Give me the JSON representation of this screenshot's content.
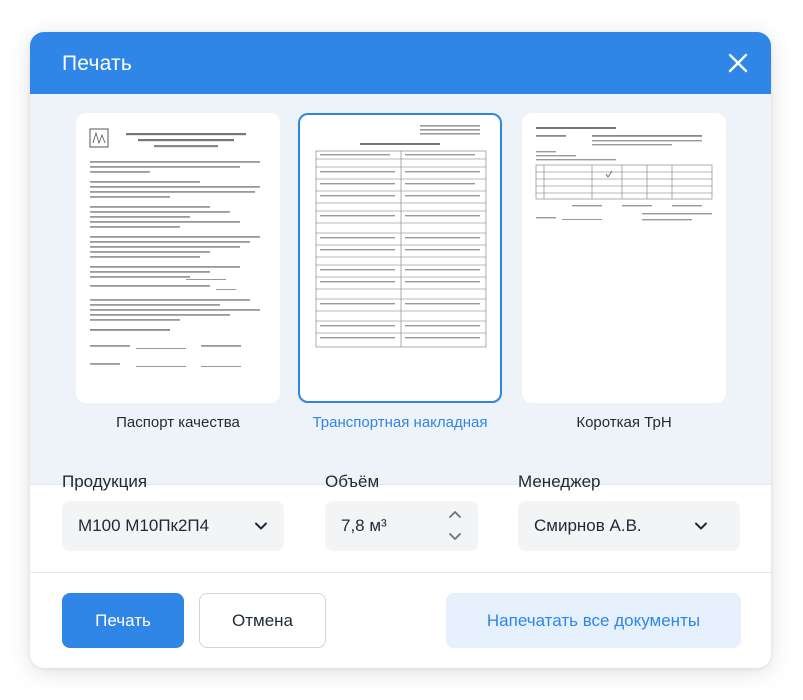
{
  "dialog": {
    "title": "Печать",
    "close_icon": "close-icon"
  },
  "documents": [
    {
      "label": "Паспорт качества",
      "selected": false
    },
    {
      "label": "Транспортная накладная",
      "selected": true
    },
    {
      "label": "Короткая ТрН",
      "selected": false
    }
  ],
  "form": {
    "product": {
      "label": "Продукция",
      "value": "М100 М10Пк2П4"
    },
    "volume": {
      "label": "Объём",
      "value": "7,8 м³"
    },
    "manager": {
      "label": "Менеджер",
      "value": "Смирнов А.В."
    }
  },
  "actions": {
    "print": "Печать",
    "cancel": "Отмена",
    "print_all": "Напечатать все документы"
  },
  "colors": {
    "accent": "#2f86e6",
    "accent_light": "#e5f0fc",
    "preview_bg": "#eef3f9"
  }
}
